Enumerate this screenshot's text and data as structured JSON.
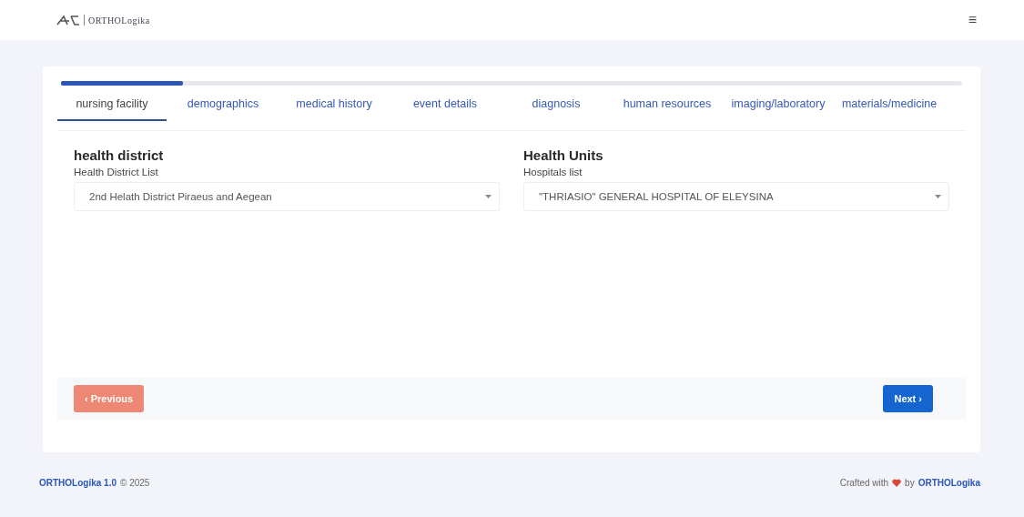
{
  "header": {
    "logo_text": "ORTHOLogika",
    "menu_icon": "≡"
  },
  "wizard": {
    "progress": {
      "level": 0.135
    },
    "tabs": [
      {
        "label": "nursing facility",
        "selected": true
      },
      {
        "label": "demographics",
        "selected": false
      },
      {
        "label": "medical history",
        "selected": false
      },
      {
        "label": "event details",
        "selected": false
      },
      {
        "label": "diagnosis",
        "selected": false
      },
      {
        "label": "human resources",
        "selected": false
      },
      {
        "label": "imaging/laboratory",
        "selected": false
      },
      {
        "label": "materials/medicine",
        "selected": false
      }
    ],
    "sections": [
      {
        "title": "health district",
        "field_label": "Health District List",
        "value": "2nd Helath District Piraeus and Aegean"
      },
      {
        "title": "Health Units",
        "field_label": "Hospitals list",
        "value": "\"THRIASIO\" GENERAL HOSPITAL OF ELEYSINA"
      }
    ],
    "previous": {
      "label": "‹ Previous",
      "disabled": true
    },
    "next": {
      "label": "Next ›",
      "disabled": false
    }
  },
  "footer": {
    "brand": "ORTHOLogika 1.0",
    "copyright": "© 2025",
    "crafted": "Crafted with",
    "by": "by",
    "author": "ORTHOLogika"
  }
}
